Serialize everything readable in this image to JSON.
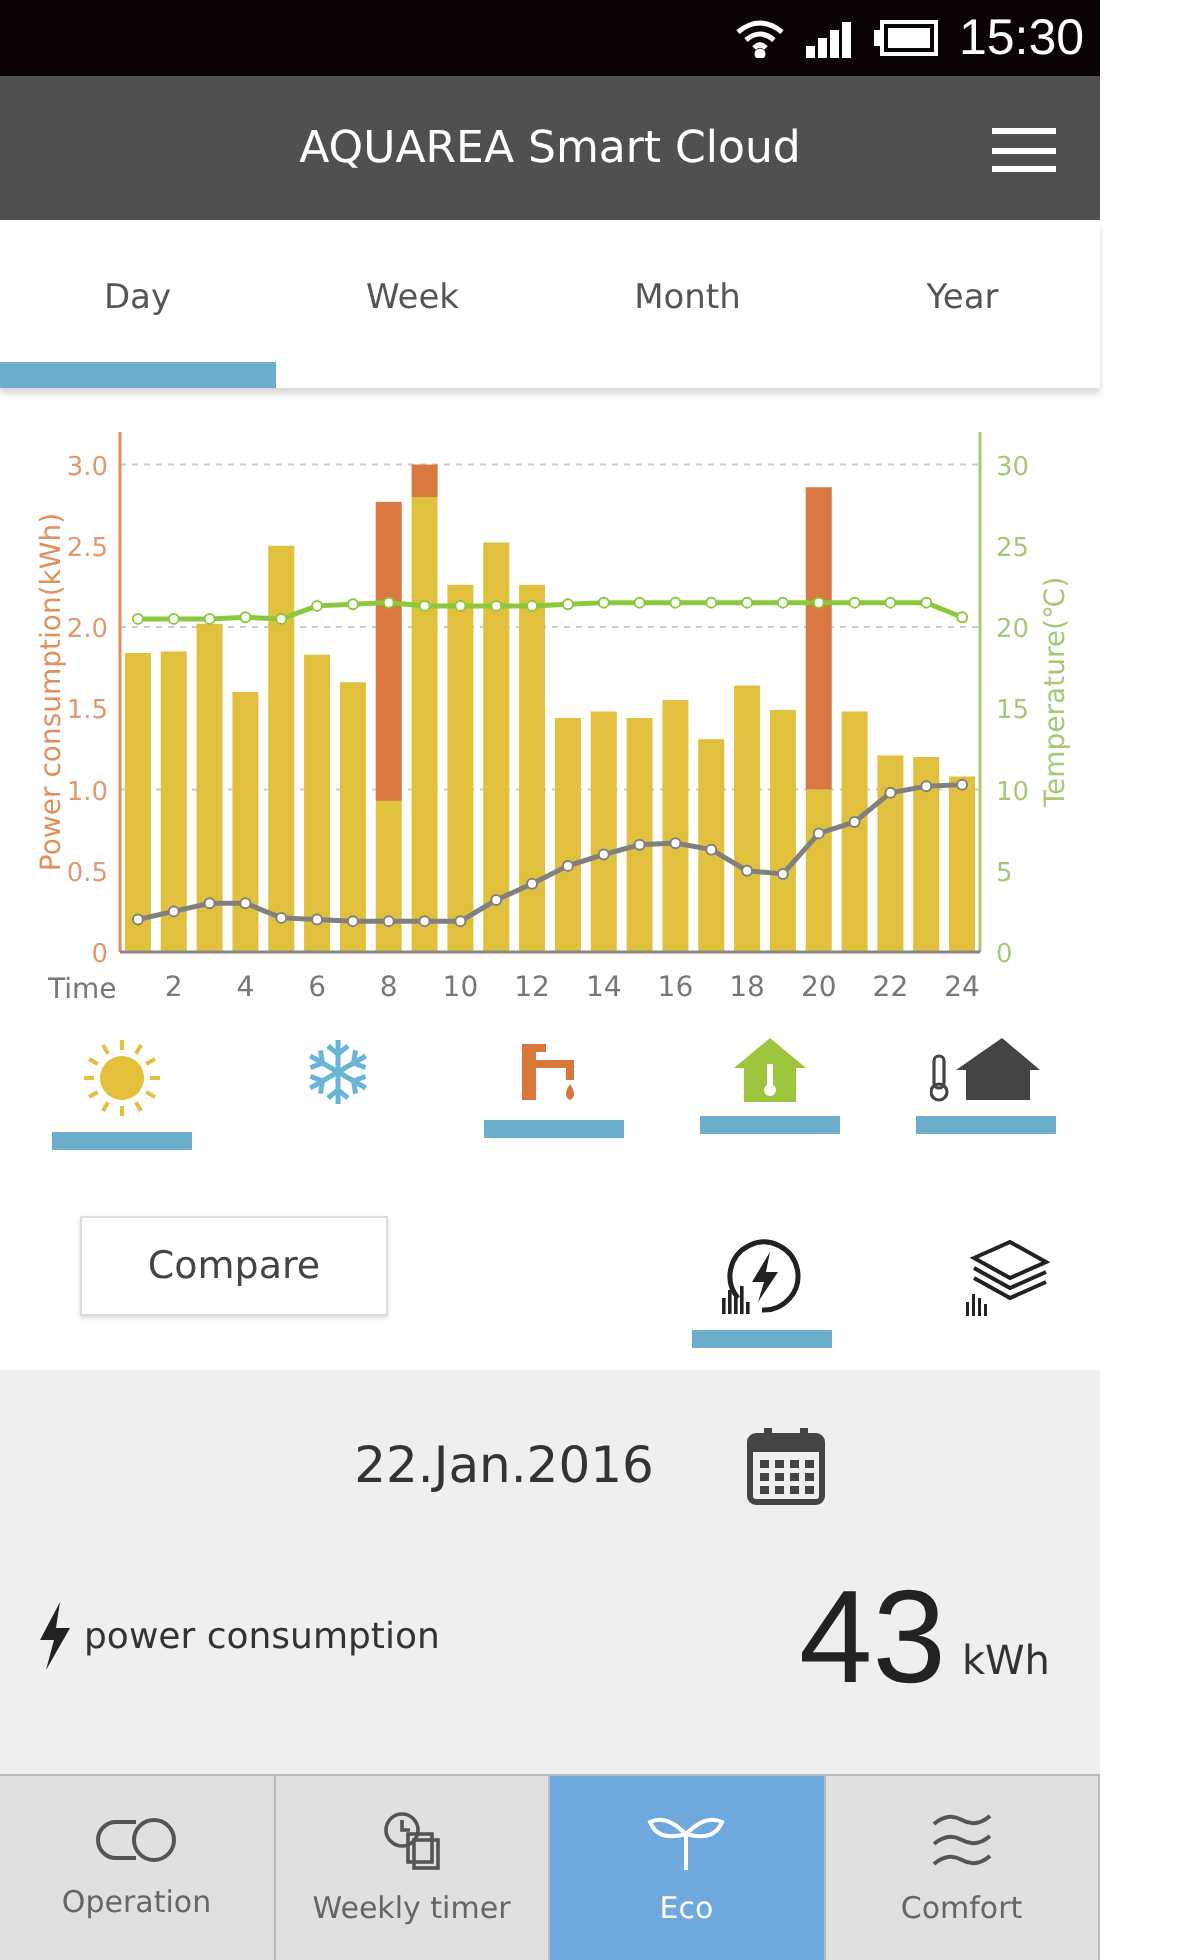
{
  "status_bar": {
    "time": "15:30"
  },
  "header": {
    "title": "AQUAREA Smart Cloud"
  },
  "tabs": [
    {
      "label": "Day",
      "selected": true
    },
    {
      "label": "Week",
      "selected": false
    },
    {
      "label": "Month",
      "selected": false
    },
    {
      "label": "Year",
      "selected": false
    }
  ],
  "chart_data": {
    "type": "bar",
    "stacked": true,
    "grid": true,
    "xlabel": "Time",
    "ylabel": "Power consumption(kWh)",
    "y2label": "Temperature(℃)",
    "xlim": [
      0.5,
      24.5
    ],
    "x": [
      1,
      2,
      3,
      4,
      5,
      6,
      7,
      8,
      9,
      10,
      11,
      12,
      13,
      14,
      15,
      16,
      17,
      18,
      19,
      20,
      21,
      22,
      23,
      24
    ],
    "xticks": [
      2,
      4,
      6,
      8,
      10,
      12,
      14,
      16,
      18,
      20,
      22,
      24
    ],
    "ylim": [
      0,
      3.2
    ],
    "yticks": [
      {
        "value": 0,
        "label": "0"
      },
      {
        "value": 0.5,
        "label": "0.5"
      },
      {
        "value": 1,
        "label": "1.0"
      },
      {
        "value": 1.5,
        "label": "1.5"
      },
      {
        "value": 2,
        "label": "2.0"
      },
      {
        "value": 2.5,
        "label": "2.5"
      },
      {
        "value": 3,
        "label": "3.0"
      }
    ],
    "y2lim": [
      0,
      32
    ],
    "y2ticks": [
      0,
      5,
      10,
      15,
      20,
      25,
      30
    ],
    "series": [
      {
        "color": "#e0c03c",
        "values": [
          1.84,
          1.85,
          2.02,
          1.6,
          2.5,
          1.83,
          1.66,
          0.93,
          2.8,
          2.26,
          2.52,
          2.26,
          1.44,
          1.48,
          1.44,
          1.55,
          1.31,
          1.64,
          1.49,
          1.0,
          1.48,
          1.21,
          1.2,
          1.08
        ]
      },
      {
        "color": "#d97840",
        "values": [
          null,
          null,
          null,
          null,
          null,
          null,
          null,
          1.84,
          0.2,
          null,
          null,
          null,
          null,
          null,
          null,
          null,
          null,
          null,
          null,
          1.86,
          null,
          null,
          null,
          null
        ]
      },
      {
        "color": "#8cc83c",
        "axis": "y2",
        "type": "line",
        "marker": "circle",
        "values": [
          20.5,
          20.5,
          20.5,
          20.6,
          20.5,
          21.3,
          21.4,
          21.5,
          21.3,
          21.3,
          21.3,
          21.3,
          21.4,
          21.5,
          21.5,
          21.5,
          21.5,
          21.5,
          21.5,
          21.5,
          21.5,
          21.5,
          21.5,
          20.6
        ]
      },
      {
        "color": "#808080",
        "axis": "y2",
        "type": "line",
        "marker": "circle",
        "values": [
          2,
          2.5,
          3,
          3,
          2.1,
          2,
          1.9,
          1.9,
          1.9,
          1.9,
          3.2,
          4.2,
          5.3,
          6,
          6.6,
          6.7,
          6.3,
          5,
          4.8,
          7.3,
          8,
          9.8,
          10.2,
          10.3
        ]
      }
    ]
  },
  "legend": [
    {
      "kind": "heat",
      "selected": true
    },
    {
      "kind": "cool",
      "selected": false
    },
    {
      "kind": "tank",
      "selected": true
    },
    {
      "kind": "indoor",
      "selected": true
    },
    {
      "kind": "outdoor",
      "selected": true
    }
  ],
  "compare_button": "Compare",
  "views": [
    {
      "kind": "power",
      "selected": true
    },
    {
      "kind": "stack",
      "selected": false
    }
  ],
  "summary": {
    "date": "22.Jan.2016",
    "label": "power consumption",
    "value": "43",
    "unit": "kWh"
  },
  "nav": [
    {
      "kind": "operation",
      "label": "Operation",
      "selected": false
    },
    {
      "kind": "timer",
      "label": "Weekly timer",
      "selected": false
    },
    {
      "kind": "eco",
      "label": "Eco",
      "selected": true
    },
    {
      "kind": "comfort",
      "label": "Comfort",
      "selected": false
    }
  ]
}
